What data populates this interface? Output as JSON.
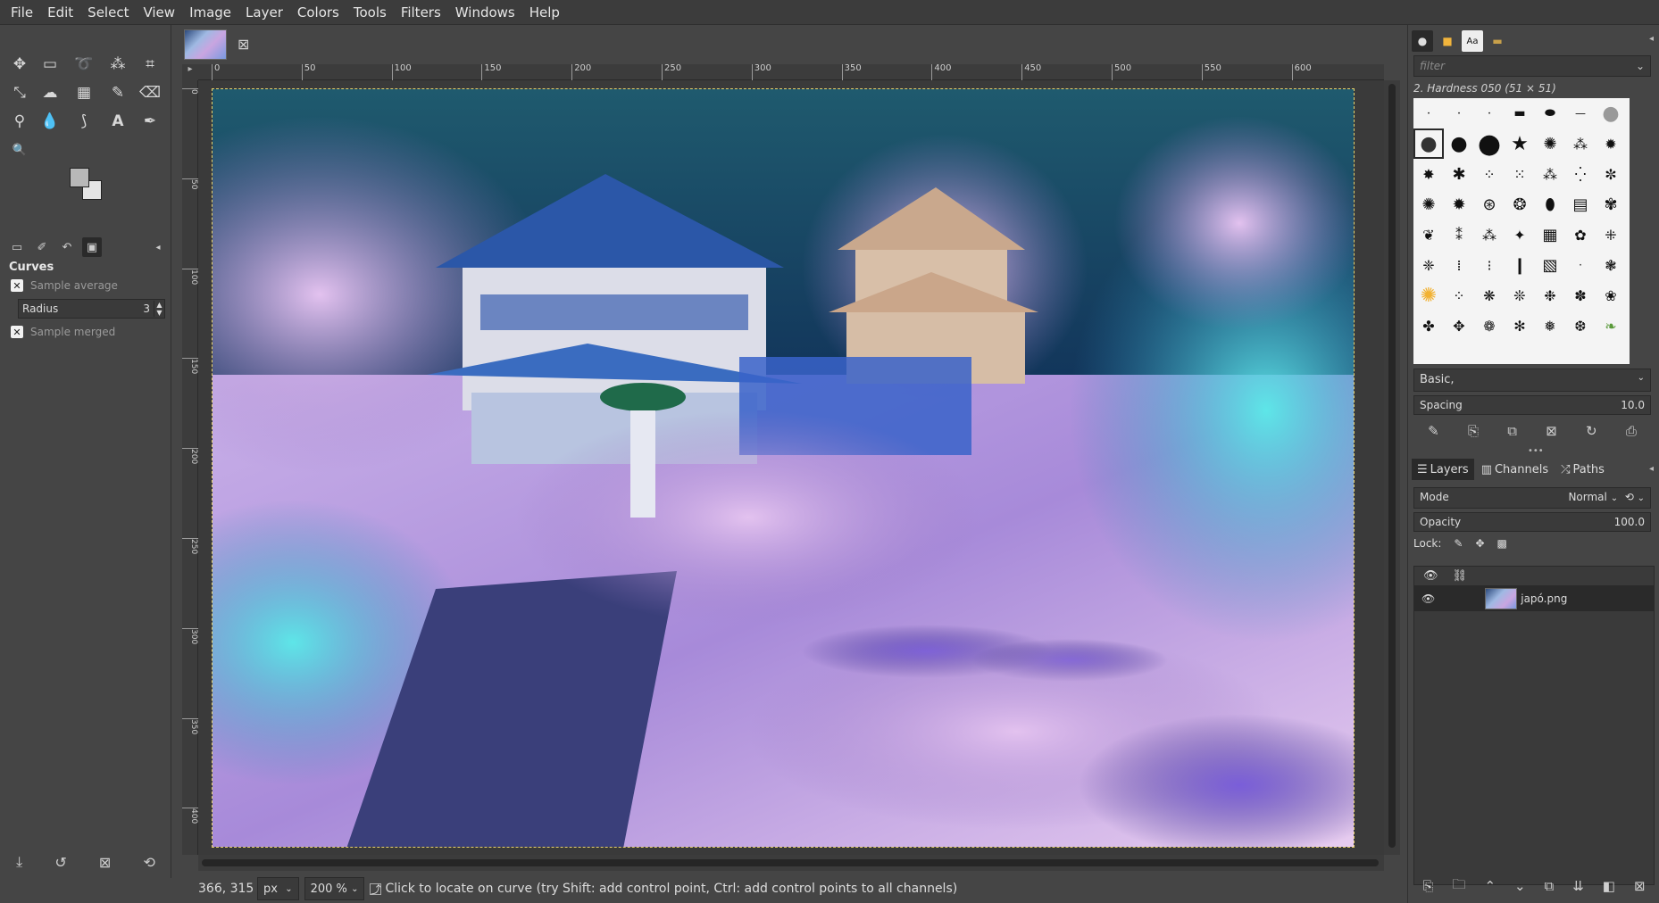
{
  "menubar": [
    "File",
    "Edit",
    "Select",
    "View",
    "Image",
    "Layer",
    "Colors",
    "Tools",
    "Filters",
    "Windows",
    "Help"
  ],
  "tools": [
    {
      "name": "move-tool-icon",
      "glyph": "✥"
    },
    {
      "name": "rect-select-icon",
      "glyph": "▭"
    },
    {
      "name": "lasso-icon",
      "glyph": "➰"
    },
    {
      "name": "fuzzy-select-icon",
      "glyph": "⁂"
    },
    {
      "name": "crop-icon",
      "glyph": "⌗"
    },
    {
      "name": "unified-transform-icon",
      "glyph": "⤡"
    },
    {
      "name": "warp-transform-icon",
      "glyph": "☁"
    },
    {
      "name": "gradient-icon",
      "glyph": "▦"
    },
    {
      "name": "paintbrush-icon",
      "glyph": "✎"
    },
    {
      "name": "eraser-icon",
      "glyph": "⌫"
    },
    {
      "name": "clone-icon",
      "glyph": "⚲"
    },
    {
      "name": "smudge-icon",
      "glyph": "💧"
    },
    {
      "name": "paths-icon",
      "glyph": "⟆"
    },
    {
      "name": "text-tool-icon",
      "glyph": "A"
    },
    {
      "name": "color-picker-icon",
      "glyph": "✒"
    },
    {
      "name": "zoom-icon",
      "glyph": "🔍"
    }
  ],
  "tool_options": {
    "title": "Curves",
    "sample_average": "Sample average",
    "radius_label": "Radius",
    "radius_value": "3",
    "sample_merged": "Sample merged"
  },
  "rulers": {
    "h_ticks": [
      "0",
      "50",
      "100",
      "150",
      "200",
      "250",
      "300",
      "350",
      "400",
      "450",
      "500",
      "550",
      "600"
    ],
    "v_ticks": [
      "0",
      "50",
      "100",
      "150",
      "200",
      "250",
      "300",
      "350",
      "400"
    ]
  },
  "statusbar": {
    "coords": "366, 315",
    "unit": "px",
    "zoom": "200 %",
    "message": "Click to locate on curve (try Shift: add control point, Ctrl: add control points to all channels)"
  },
  "brushes": {
    "filter_placeholder": "filter",
    "selected_name": "2. Hardness 050 (51 × 51)",
    "preset": "Basic,",
    "spacing_label": "Spacing",
    "spacing_value": "10.0"
  },
  "layers": {
    "tabs": [
      "Layers",
      "Channels",
      "Paths"
    ],
    "mode_label": "Mode",
    "mode_value": "Normal",
    "opacity_label": "Opacity",
    "opacity_value": "100.0",
    "lock_label": "Lock:",
    "layer_name": "japó.png"
  }
}
